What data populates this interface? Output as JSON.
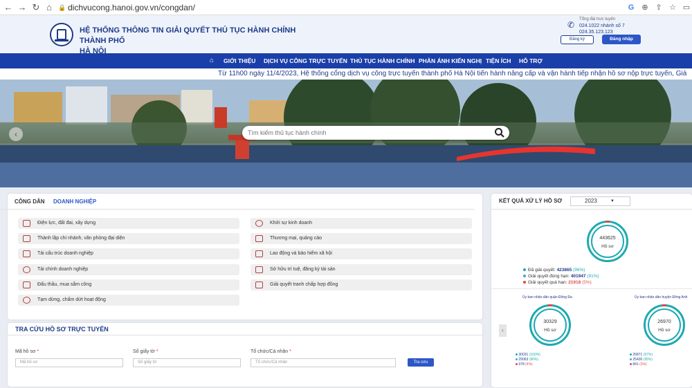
{
  "browser": {
    "url": "dichvucong.hanoi.gov.vn/congdan/"
  },
  "header": {
    "title_line1": "HỆ THỐNG THÔNG TIN GIẢI QUYẾT THỦ TỤC HÀNH CHÍNH THÀNH PHỐ",
    "title_line2": "HÀ NỘI",
    "hotline_label": "Tổng đài trực tuyến",
    "hotline1": "024.1022 nhánh số 7",
    "hotline2": "024.35.123.123",
    "register": "Đăng ký",
    "login": "Đăng nhập"
  },
  "menu": [
    "GIỚI THIỆU",
    "DỊCH VỤ CÔNG TRỰC TUYẾN",
    "THỦ TỤC HÀNH CHÍNH",
    "PHẢN ÁNH KIẾN NGHỊ",
    "TIỆN ÍCH",
    "HỖ TRỢ"
  ],
  "marquee": "Từ 11h00 ngày 11/4/2023, Hệ thống cổng dịch vụ công trực tuyến thành phố Hà Nội tiến hành nâng cấp và vận hành tiếp nhận hồ sơ nộp trực tuyến, Giá",
  "search": {
    "placeholder": "Tìm kiếm thủ tục hành chính"
  },
  "tabs": {
    "citizen": "CÔNG DÂN",
    "business": "DOANH NGHIỆP"
  },
  "categories_left": [
    "Điện lực, đất đai, xây dựng",
    "Thành lập chi nhánh, văn phòng đại diện",
    "Tái cấu trúc doanh nghiệp",
    "Tài chính doanh nghiệp",
    "Đấu thầu, mua sắm công",
    "Tạm dừng, chấm dứt hoạt động"
  ],
  "categories_right": [
    "Khởi sự kinh doanh",
    "Thương mại, quảng cáo",
    "Lao động và bảo hiểm xã hội",
    "Sở hữu trí tuệ, đăng ký tài sản",
    "Giải quyết tranh chấp hợp đồng"
  ],
  "lookup": {
    "title": "TRA CỨU HỒ SƠ TRỰC TUYẾN",
    "f1_label": "Mã hồ sơ",
    "f1_ph": "Mã hồ sơ",
    "f2_label": "Số giấy tờ",
    "f2_ph": "Số giấy tờ",
    "f3_label": "Tổ chức/Cá nhân",
    "f3_ph": "Tổ chức/Cá nhân",
    "button": "Tra cứu"
  },
  "results": {
    "title": "KẾT QUẢ XỬ LÝ HỒ SƠ",
    "year": "2023",
    "total": "443625",
    "unit": "Hồ sơ",
    "l1_label": "Đã giải quyết:",
    "l1_value": "423865",
    "l1_pct": "(96%)",
    "l2_label": "Giải quyết đúng hạn:",
    "l2_value": "401947",
    "l2_pct": "(91%)",
    "l3_label": "Giải quyết quá hạn:",
    "l3_value": "21918",
    "l3_pct": "(5%)",
    "unit1_name": "Ủy ban nhân dân quận Đống Đa",
    "unit1_total": "30329",
    "unit1_l1": "30031",
    "unit1_p1": "(100%)",
    "unit1_l2": "29063",
    "unit1_p2": "(96%)",
    "unit1_l3": "978",
    "unit1_p3": "(4%)",
    "unit2_name": "Ủy ban nhân dân huyện Đông Anh",
    "unit2_total": "26970",
    "unit2_l1": "26871",
    "unit2_p1": "(97%)",
    "unit2_l2": "25430",
    "unit2_p2": "(95%)",
    "unit2_l3": "841",
    "unit2_p3": "(3%)",
    "colors": {
      "done": "#1ea9b0",
      "ontime": "#3fa7d6",
      "late": "#e04848"
    }
  }
}
